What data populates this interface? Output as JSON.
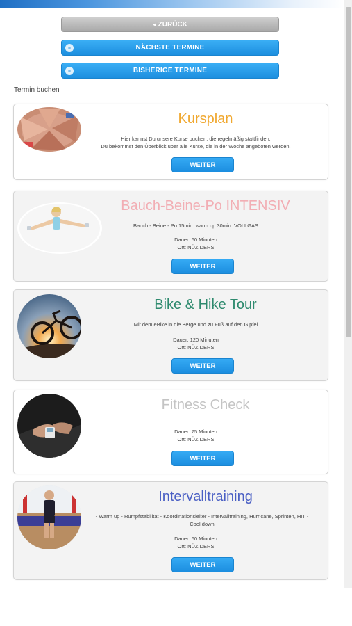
{
  "nav": {
    "back_label": "ZURÜCK",
    "back_icon": "arrow-left-icon",
    "next_label": "NÄCHSTE TERMINE",
    "previous_label": "BISHERIGE TERMINE",
    "calendar_icon": "calendar-icon"
  },
  "section_label": "Termin buchen",
  "cards": [
    {
      "title": "Kursplan",
      "title_color": "#f0a830",
      "desc": [
        "Hier kannst Du unsere Kurse buchen, die regelmäßig stattfinden.",
        "Du bekommst den Überblick über alle Kurse, die in der Woche angeboten werden."
      ],
      "button": "WEITER"
    },
    {
      "title": "Bauch-Beine-Po INTENSIV",
      "title_color": "#f2aeb4",
      "desc": [
        "Bauch - Beine - Po 15min. warm up 30min. VOLLGAS"
      ],
      "meta": [
        "Dauer: 60 Minuten",
        "Ort: NÜZIDERS"
      ],
      "button": "WEITER"
    },
    {
      "title": "Bike & Hike Tour",
      "title_color": "#2e8a6e",
      "desc": [
        "Mit dem eBike in die Berge und zu Fuß auf den Gipfel"
      ],
      "meta": [
        "Dauer: 120 Minuten",
        "Ort: NÜZIDERS"
      ],
      "button": "WEITER"
    },
    {
      "title": "Fitness Check",
      "title_color": "#c4c4c4",
      "meta": [
        "Dauer: 75 Minuten",
        "Ort: NÜZIDERS"
      ],
      "button": "WEITER"
    },
    {
      "title": "Intervalltraining",
      "title_color": "#4a5fc4",
      "desc": [
        "- Warm up - Rumpfstabilität - Koordinationsleiter - Intervalltraining, Hurricane, Sprinten, HIT -",
        "Cool down"
      ],
      "meta": [
        "Dauer: 60 Minuten",
        "Ort: NÜZIDERS"
      ],
      "button": "WEITER"
    }
  ]
}
